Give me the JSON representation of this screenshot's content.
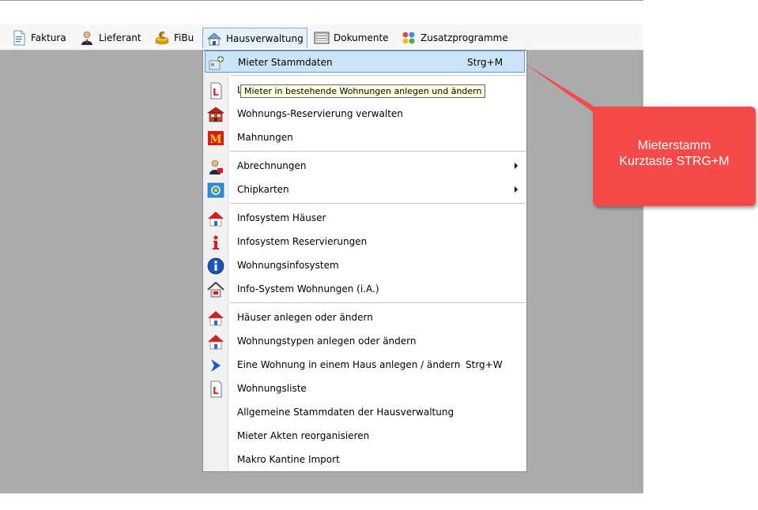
{
  "menubar": {
    "items": [
      {
        "label": "Faktura",
        "icon": "invoice-icon"
      },
      {
        "label": "Lieferant",
        "icon": "supplier-person-icon"
      },
      {
        "label": "FiBu",
        "icon": "euro-coins-icon"
      },
      {
        "label": "Hausverwaltung",
        "icon": "house-icon"
      },
      {
        "label": "Dokumente",
        "icon": "document-icon"
      },
      {
        "label": "Zusatzprogramme",
        "icon": "puzzle-icon"
      }
    ]
  },
  "dropdown": {
    "items": [
      {
        "label": "Mieter Stammdaten",
        "shortcut": "Strg+M"
      },
      {
        "label": "L"
      },
      {
        "label": "Wohnungs-Reservierung verwalten"
      },
      {
        "label": "Mahnungen"
      },
      {
        "label": "Abrechnungen"
      },
      {
        "label": "Chipkarten"
      },
      {
        "label": "Infosystem Häuser"
      },
      {
        "label": "Infosystem Reservierungen"
      },
      {
        "label": "Wohnungsinfosystem"
      },
      {
        "label": "Info-System Wohnungen (i.A.)"
      },
      {
        "label": "Häuser anlegen oder ändern"
      },
      {
        "label": "Wohnungstypen anlegen oder ändern"
      },
      {
        "label": "Eine Wohnung in einem Haus anlegen / ändern",
        "shortcut": "Strg+W"
      },
      {
        "label": "Wohnungsliste"
      },
      {
        "label": "Allgemeine Stammdaten der Hausverwaltung"
      },
      {
        "label": "Mieter Akten reorganisieren"
      },
      {
        "label": "Makro Kantine Import"
      }
    ]
  },
  "tooltip": {
    "text": "Mieter in bestehende Wohnungen anlegen und ändern"
  },
  "callout": {
    "line1": "Mieterstamm",
    "line2": "Kurztaste STRG+M"
  },
  "colors": {
    "highlight": "#cce4f7",
    "highlight_border": "#5a9ad6",
    "callout": "#f54a4a",
    "workspace": "#ababab"
  }
}
